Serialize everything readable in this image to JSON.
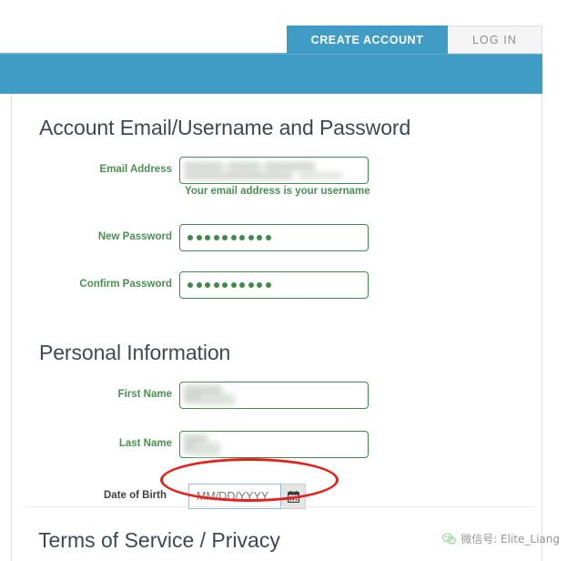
{
  "tabs": [
    {
      "label": "CREATE ACCOUNT",
      "state": "active"
    },
    {
      "label": "LOG IN",
      "state": "inactive"
    }
  ],
  "sections": [
    {
      "title": "Account Email/Username and Password",
      "fields": [
        {
          "label": "Email Address",
          "value_type": "redacted",
          "helper": "Your email address is your username"
        },
        {
          "label": "New Password",
          "value_type": "password",
          "dots": 10
        },
        {
          "label": "Confirm Password",
          "value_type": "password",
          "dots": 10
        }
      ]
    },
    {
      "title": "Personal Information",
      "fields": [
        {
          "label": "First Name",
          "value_type": "redacted"
        },
        {
          "label": "Last Name",
          "value_type": "redacted"
        }
      ]
    }
  ],
  "date_of_birth": {
    "label": "Date of Birth",
    "placeholder": "MM/DD/YYYY",
    "value": "",
    "button_icon": "calendar-icon",
    "annotated": true
  },
  "footer": {
    "terms_title": "Terms of Service / Privacy"
  },
  "watermark": {
    "icon": "wechat-icon",
    "text": "微信号: Elite_Liang"
  },
  "colors": {
    "brand_teal": "#409cc4",
    "label_green": "#4a8f52",
    "input_border_green": "#3f8a4a",
    "heading_slate": "#3d4852",
    "annotation_red": "#e8201c",
    "tab_inactive_bg": "#f5f5f5",
    "wechat_green": "#5ec25e"
  }
}
